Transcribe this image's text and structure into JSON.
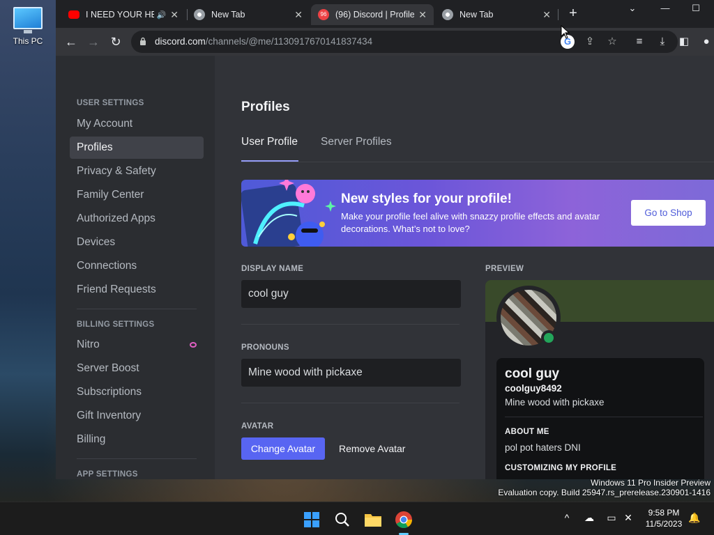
{
  "desktop": {
    "icon_label": "This PC"
  },
  "browser": {
    "tabs": [
      {
        "title": "I NEED YOUR HE",
        "favicon": "youtube-icon",
        "audio": true
      },
      {
        "title": "New Tab",
        "favicon": "chrome-icon"
      },
      {
        "title": "(96) Discord | Profile",
        "favicon": "discord-icon",
        "active": true
      },
      {
        "title": "New Tab",
        "favicon": "chrome-icon"
      }
    ],
    "url_host": "discord.com",
    "url_path": "/channels/@me/1130917670141837434"
  },
  "sidebar": {
    "user_settings_header": "USER SETTINGS",
    "user_items": [
      "My Account",
      "Profiles",
      "Privacy & Safety",
      "Family Center",
      "Authorized Apps",
      "Devices",
      "Connections",
      "Friend Requests"
    ],
    "selected": "Profiles",
    "billing_settings_header": "BILLING SETTINGS",
    "billing_items": [
      "Nitro",
      "Server Boost",
      "Subscriptions",
      "Gift Inventory",
      "Billing"
    ],
    "app_settings_header": "APP SETTINGS"
  },
  "main": {
    "title": "Profiles",
    "tabs": [
      "User Profile",
      "Server Profiles"
    ],
    "banner": {
      "title": "New styles for your profile!",
      "description": "Make your profile feel alive with snazzy profile effects and avatar decorations. What’s not to love?",
      "button": "Go to Shop"
    },
    "display_name_label": "DISPLAY NAME",
    "display_name_value": "cool guy",
    "pronouns_label": "PRONOUNS",
    "pronouns_value": "Mine wood with pickaxe",
    "avatar_label": "AVATAR",
    "change_avatar": "Change Avatar",
    "remove_avatar": "Remove Avatar",
    "preview_label": "PREVIEW"
  },
  "preview": {
    "name": "cool guy",
    "username": "coolguy8492",
    "pronouns": "Mine wood with pickaxe",
    "about_header": "ABOUT ME",
    "about_text": "pol pot haters DNI",
    "customizing_header": "CUSTOMIZING MY PROFILE",
    "status_color": "#23a55a"
  },
  "watermark": {
    "line1": "Windows 11 Pro Insider Preview",
    "line2": "Evaluation copy. Build 25947.rs_prerelease.230901-1416"
  },
  "taskbar": {
    "time": "9:58 PM",
    "date": "11/5/2023"
  },
  "colors": {
    "discord_blurple": "#5865f2",
    "sidebar_bg": "#2b2d31",
    "content_bg": "#313338"
  }
}
